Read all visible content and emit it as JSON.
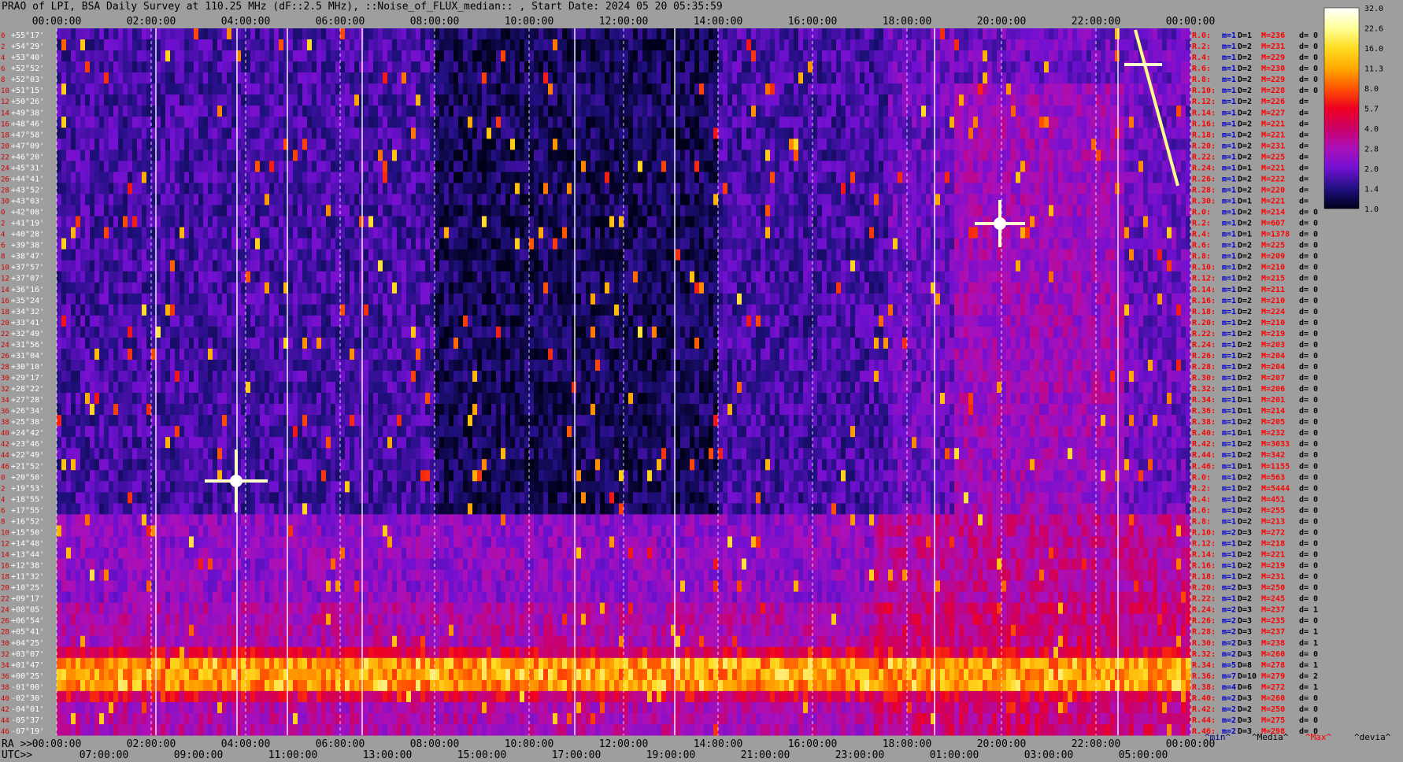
{
  "title": "PRAO of LPI, BSA Daily Survey at 110.25 MHz (dF::2.5 MHz), ::Noise_of_FLUX_median:: , Start Date: 2024 05 20 05:35:59",
  "chart_data": {
    "type": "heatmap",
    "title": "PRAO of LPI, BSA Daily Survey at 110.25 MHz (dF::2.5 MHz), ::Noise_of_FLUX_median:: , Start Date: 2024 05 20 05:35:59",
    "x_top_ticks": [
      "00:00:00",
      "02:00:00",
      "04:00:00",
      "06:00:00",
      "08:00:00",
      "10:00:00",
      "12:00:00",
      "14:00:00",
      "16:00:00",
      "18:00:00",
      "20:00:00",
      "22:00:00",
      "00:00:00"
    ],
    "x_ra_prefix": "RA >>",
    "x_ra_ticks": [
      "00:00:00",
      "02:00:00",
      "04:00:00",
      "06:00:00",
      "08:00:00",
      "10:00:00",
      "12:00:00",
      "14:00:00",
      "16:00:00",
      "18:00:00",
      "20:00:00",
      "22:00:00",
      "00:00:00"
    ],
    "x_utc_prefix": "UTC>>",
    "x_utc_ticks": [
      "07:00:00",
      "09:00:00",
      "11:00:00",
      "13:00:00",
      "15:00:00",
      "17:00:00",
      "19:00:00",
      "21:00:00",
      "23:00:00",
      "01:00:00",
      "03:00:00",
      "05:00:00"
    ],
    "y_ticks": [
      "+55°17'",
      "+54°29'",
      "+53°40'",
      "+52°52'",
      "+52°03'",
      "+51°15'",
      "+50°26'",
      "+49°38'",
      "+48°46'",
      "+47°58'",
      "+47°09'",
      "+46°20'",
      "+45°31'",
      "+44°41'",
      "+43°52'",
      "+43°03'",
      "+42°08'",
      "+41°19'",
      "+40°28'",
      "+39°38'",
      "+38°47'",
      "+37°57'",
      "+37°07'",
      "+36°16'",
      "+35°24'",
      "+34°32'",
      "+33°41'",
      "+32°49'",
      "+31°56'",
      "+31°04'",
      "+30°10'",
      "+29°17'",
      "+28°22'",
      "+27°28'",
      "+26°34'",
      "+25°38'",
      "+24°42'",
      "+23°46'",
      "+22°49'",
      "+21°52'",
      "+20°50'",
      "+19°53'",
      "+18°55'",
      "+17°55'",
      "+16°52'",
      "+15°50'",
      "+14°48'",
      "+13°44'",
      "+12°38'",
      "+11°32'",
      "+10°25'",
      "+09°17'",
      "+08°05'",
      "+06°54'",
      "+05°41'",
      "+04°25'",
      "+03°07'",
      "+01°47'",
      "+00°25'",
      "-01°00'",
      "-02°30'",
      "-04°01'",
      "-05°37'",
      "-07°19'"
    ],
    "row_index_labels": [
      "0",
      "2",
      "4",
      "6",
      "8",
      "10",
      "12",
      "14",
      "16",
      "18",
      "20",
      "22",
      "24",
      "26",
      "28",
      "30",
      "0",
      "2",
      "4",
      "6",
      "8",
      "10",
      "12",
      "14",
      "16",
      "18",
      "20",
      "22",
      "24",
      "26",
      "28",
      "30",
      "32",
      "34",
      "36",
      "38",
      "40",
      "42",
      "44",
      "46",
      "0",
      "2",
      "4",
      "6",
      "8",
      "10",
      "12",
      "14",
      "16",
      "18",
      "20",
      "22",
      "24",
      "26",
      "28",
      "30",
      "32",
      "34",
      "36",
      "38",
      "40",
      "42",
      "44",
      "46"
    ],
    "colorbar": {
      "ticks": [
        "32.0",
        "22.6",
        "16.0",
        "11.3",
        "8.0",
        "5.7",
        "4.0",
        "2.8",
        "2.0",
        "1.4",
        "1.0"
      ],
      "colors": [
        "#ffffff",
        "#ffff99",
        "#ffdd22",
        "#ffaa00",
        "#ff5500",
        "#ee0022",
        "#cc0066",
        "#aa10bb",
        "#7010d0",
        "#201080",
        "#000018"
      ]
    },
    "right_table": {
      "rows": [
        [
          "R.0:",
          "m=1",
          "D=1",
          "M=236",
          "d= 0"
        ],
        [
          "R.2:",
          "m=1",
          "D=2",
          "M=231",
          "d= 0"
        ],
        [
          "R.4:",
          "m=1",
          "D=2",
          "M=229",
          "d= 0"
        ],
        [
          "R.6:",
          "m=1",
          "D=2",
          "M=230",
          "d= 0"
        ],
        [
          "R.8:",
          "m=1",
          "D=2",
          "M=229",
          "d= 0"
        ],
        [
          "R.10:",
          "m=1",
          "D=2",
          "M=228",
          "d= 0"
        ],
        [
          "R.12:",
          "m=1",
          "D=2",
          "M=226",
          "d="
        ],
        [
          "R.14:",
          "m=1",
          "D=2",
          "M=227",
          "d="
        ],
        [
          "R.16:",
          "m=1",
          "D=2",
          "M=221",
          "d="
        ],
        [
          "R.18:",
          "m=1",
          "D=2",
          "M=221",
          "d="
        ],
        [
          "R.20:",
          "m=1",
          "D=2",
          "M=231",
          "d="
        ],
        [
          "R.22:",
          "m=1",
          "D=2",
          "M=225",
          "d="
        ],
        [
          "R.24:",
          "m=1",
          "D=1",
          "M=221",
          "d="
        ],
        [
          "R.26:",
          "m=1",
          "D=2",
          "M=222",
          "d="
        ],
        [
          "R.28:",
          "m=1",
          "D=2",
          "M=220",
          "d="
        ],
        [
          "R.30:",
          "m=1",
          "D=1",
          "M=221",
          "d="
        ],
        [
          "R.0:",
          "m=1",
          "D=2",
          "M=214",
          "d= 0"
        ],
        [
          "R.2:",
          "m=1",
          "D=2",
          "M=607",
          "d= 0"
        ],
        [
          "R.4:",
          "m=1",
          "D=1",
          "M=1378",
          "d= 0"
        ],
        [
          "R.6:",
          "m=1",
          "D=2",
          "M=225",
          "d= 0"
        ],
        [
          "R.8:",
          "m=1",
          "D=2",
          "M=209",
          "d= 0"
        ],
        [
          "R.10:",
          "m=1",
          "D=2",
          "M=210",
          "d= 0"
        ],
        [
          "R.12:",
          "m=1",
          "D=2",
          "M=215",
          "d= 0"
        ],
        [
          "R.14:",
          "m=1",
          "D=2",
          "M=211",
          "d= 0"
        ],
        [
          "R.16:",
          "m=1",
          "D=2",
          "M=210",
          "d= 0"
        ],
        [
          "R.18:",
          "m=1",
          "D=2",
          "M=224",
          "d= 0"
        ],
        [
          "R.20:",
          "m=1",
          "D=2",
          "M=210",
          "d= 0"
        ],
        [
          "R.22:",
          "m=1",
          "D=2",
          "M=219",
          "d= 0"
        ],
        [
          "R.24:",
          "m=1",
          "D=2",
          "M=203",
          "d= 0"
        ],
        [
          "R.26:",
          "m=1",
          "D=2",
          "M=204",
          "d= 0"
        ],
        [
          "R.28:",
          "m=1",
          "D=2",
          "M=204",
          "d= 0"
        ],
        [
          "R.30:",
          "m=1",
          "D=2",
          "M=207",
          "d= 0"
        ],
        [
          "R.32:",
          "m=1",
          "D=1",
          "M=206",
          "d= 0"
        ],
        [
          "R.34:",
          "m=1",
          "D=1",
          "M=201",
          "d= 0"
        ],
        [
          "R.36:",
          "m=1",
          "D=1",
          "M=214",
          "d= 0"
        ],
        [
          "R.38:",
          "m=1",
          "D=2",
          "M=205",
          "d= 0"
        ],
        [
          "R.40:",
          "m=1",
          "D=1",
          "M=232",
          "d= 0"
        ],
        [
          "R.42:",
          "m=1",
          "D=2",
          "M=3033",
          "d= 0"
        ],
        [
          "R.44:",
          "m=1",
          "D=2",
          "M=342",
          "d= 0"
        ],
        [
          "R.46:",
          "m=1",
          "D=1",
          "M=1155",
          "d= 0"
        ],
        [
          "R.0:",
          "m=1",
          "D=2",
          "M=563",
          "d= 0"
        ],
        [
          "R.2:",
          "m=1",
          "D=2",
          "M=5444",
          "d= 0"
        ],
        [
          "R.4:",
          "m=1",
          "D=2",
          "M=451",
          "d= 0"
        ],
        [
          "R.6:",
          "m=1",
          "D=2",
          "M=255",
          "d= 0"
        ],
        [
          "R.8:",
          "m=1",
          "D=2",
          "M=213",
          "d= 0"
        ],
        [
          "R.10:",
          "m=2",
          "D=3",
          "M=272",
          "d= 0"
        ],
        [
          "R.12:",
          "m=1",
          "D=2",
          "M=218",
          "d= 0"
        ],
        [
          "R.14:",
          "m=1",
          "D=2",
          "M=221",
          "d= 0"
        ],
        [
          "R.16:",
          "m=1",
          "D=2",
          "M=219",
          "d= 0"
        ],
        [
          "R.18:",
          "m=1",
          "D=2",
          "M=231",
          "d= 0"
        ],
        [
          "R.20:",
          "m=2",
          "D=3",
          "M=250",
          "d= 0"
        ],
        [
          "R.22:",
          "m=1",
          "D=2",
          "M=245",
          "d= 0"
        ],
        [
          "R.24:",
          "m=2",
          "D=3",
          "M=237",
          "d= 1"
        ],
        [
          "R.26:",
          "m=2",
          "D=3",
          "M=235",
          "d= 0"
        ],
        [
          "R.28:",
          "m=2",
          "D=3",
          "M=237",
          "d= 1"
        ],
        [
          "R.30:",
          "m=2",
          "D=3",
          "M=238",
          "d= 1"
        ],
        [
          "R.32:",
          "m=2",
          "D=3",
          "M=260",
          "d= 0"
        ],
        [
          "R.34:",
          "m=5",
          "D=8",
          "M=278",
          "d= 1"
        ],
        [
          "R.36:",
          "m=7",
          "D=10",
          "M=279",
          "d= 2"
        ],
        [
          "R.38:",
          "m=4",
          "D=6",
          "M=272",
          "d= 1"
        ],
        [
          "R.40:",
          "m=2",
          "D=3",
          "M=260",
          "d= 0"
        ],
        [
          "R.42:",
          "m=2",
          "D=2",
          "M=250",
          "d= 0"
        ],
        [
          "R.44:",
          "m=2",
          "D=3",
          "M=275",
          "d= 0"
        ],
        [
          "R.46:",
          "m=2",
          "D=3",
          "M=298",
          "d= 0"
        ]
      ],
      "legend": [
        "^min^",
        "^Media^",
        "^Max^",
        "^devia^"
      ],
      "legend_colors": [
        "#000080",
        "#000000",
        "#ff0000",
        "#000000"
      ]
    },
    "colors": {
      "background": "#9e9e9e",
      "label_red": "#ff0000",
      "label_blue": "#0000cc",
      "label_black": "#000000",
      "row_index_red": "#d00000"
    }
  }
}
